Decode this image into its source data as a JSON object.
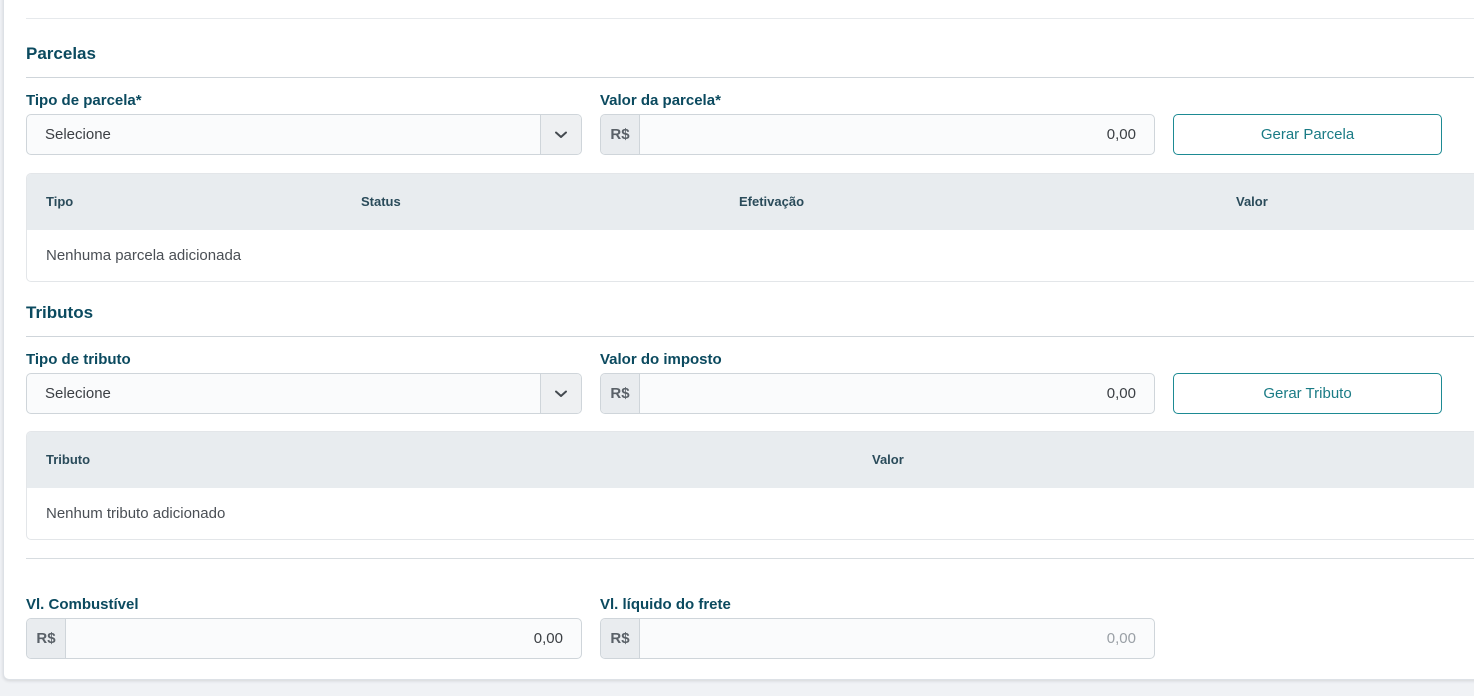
{
  "parcelas": {
    "title": "Parcelas",
    "tipo_label": "Tipo de parcela*",
    "tipo_value": "Selecione",
    "valor_label": "Valor da parcela*",
    "currency": "R$",
    "valor_value": "0,00",
    "button_label": "Gerar Parcela",
    "table": {
      "columns": [
        "Tipo",
        "Status",
        "Efetivação",
        "Valor"
      ],
      "empty_text": "Nenhuma parcela adicionada"
    }
  },
  "tributos": {
    "title": "Tributos",
    "tipo_label": "Tipo de tributo",
    "tipo_value": "Selecione",
    "valor_label": "Valor do imposto",
    "currency": "R$",
    "valor_value": "0,00",
    "button_label": "Gerar Tributo",
    "table": {
      "columns": [
        "Tributo",
        "Valor"
      ],
      "empty_text": "Nenhum tributo adicionado"
    }
  },
  "totais": {
    "combustivel_label": "Vl. Combustível",
    "combustivel_currency": "R$",
    "combustivel_value": "0,00",
    "liquido_label": "Vl. líquido do frete",
    "liquido_currency": "R$",
    "liquido_value": "0,00"
  },
  "icons": {
    "caret": "chevron-down-icon"
  },
  "colors": {
    "heading": "#0b4a5f",
    "accent": "#1d8a93",
    "table_header_bg": "#e8ecef"
  }
}
